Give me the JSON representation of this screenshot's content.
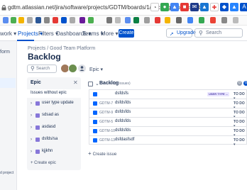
{
  "browser": {
    "url": "gdtm.atlassian.net/jira/software/projects/GDTM/boards/1/backlog?epics=visible"
  },
  "nav": {
    "items": [
      {
        "label": "work ▾"
      },
      {
        "label": "Projects ▾"
      },
      {
        "label": "Filters ▾"
      },
      {
        "label": "Dashboards ▾"
      },
      {
        "label": "Teams ▾"
      },
      {
        "label": "More ▾"
      }
    ],
    "create_label": "Create",
    "upgrade_label": "Upgrade",
    "search_placeholder": "Search"
  },
  "sidebar": {
    "top_label": "form",
    "bottom_label": "d project"
  },
  "breadcrumb": "Projects  /  Good Team Platform",
  "page_title": "Backlog",
  "filters": {
    "search_placeholder": "Search",
    "epic_label": "Epic ▾"
  },
  "epic_panel": {
    "title": "Epic",
    "close_icon": "✕",
    "no_epic_label": "Issues without epic",
    "items": [
      {
        "name": "user type update"
      },
      {
        "name": "sdsad as"
      },
      {
        "name": "asdasd"
      },
      {
        "name": "dsfds/sa"
      },
      {
        "name": "kjjkhn"
      }
    ],
    "create_label": "+ Create epic",
    "epic_color": "#8777d9"
  },
  "backlog": {
    "title": "Backlog",
    "count": "(6 issues)",
    "badges": [
      {
        "value": "0",
        "color": "#97a0af"
      },
      {
        "value": "0",
        "color": "#0052cc"
      }
    ],
    "issues": [
      {
        "key": "",
        "summary": "dsfdsfs",
        "epic": "USER TYPE ...",
        "status": "TO DO ▾"
      },
      {
        "key": "GDTM-7",
        "summary": "dsfdsfds",
        "epic": "",
        "status": "TO DO ▾"
      },
      {
        "key": "GDTM-9",
        "summary": "dsfdsfds",
        "epic": "",
        "status": "TO DO ▾"
      },
      {
        "key": "GDTM-5",
        "summary": "dsfdsfds",
        "epic": "",
        "status": "TO DO ▾"
      },
      {
        "key": "GDTM-10",
        "summary": "dsfdsfds",
        "epic": "",
        "status": "TO DO ▾"
      },
      {
        "key": "GDTM-13",
        "summary": "dsfdasfsdf",
        "epic": "",
        "status": "TO DO ▾"
      }
    ],
    "create_issue_label": "Create issue"
  },
  "colors": {
    "accent": "#0052cc",
    "checkbox": "#0065ff"
  }
}
